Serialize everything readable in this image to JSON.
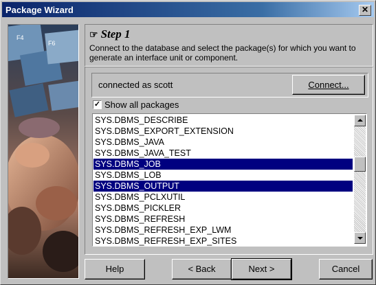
{
  "window": {
    "title": "Package Wizard",
    "close_label": "✕"
  },
  "step": {
    "title": "Step 1",
    "description": "Connect to the database and select the package(s) for which you want to generate an interface unit or component."
  },
  "connection": {
    "status": "connected as scott",
    "connect_button": "Connect..."
  },
  "show_all": {
    "checked": true,
    "mark": "✓",
    "label": "Show all packages"
  },
  "packages": [
    {
      "name": "SYS.DBMS_DESCRIBE",
      "selected": false
    },
    {
      "name": "SYS.DBMS_EXPORT_EXTENSION",
      "selected": false
    },
    {
      "name": "SYS.DBMS_JAVA",
      "selected": false
    },
    {
      "name": "SYS.DBMS_JAVA_TEST",
      "selected": false
    },
    {
      "name": "SYS.DBMS_JOB",
      "selected": true
    },
    {
      "name": "SYS.DBMS_LOB",
      "selected": false
    },
    {
      "name": "SYS.DBMS_OUTPUT",
      "selected": true
    },
    {
      "name": "SYS.DBMS_PCLXUTIL",
      "selected": false
    },
    {
      "name": "SYS.DBMS_PICKLER",
      "selected": false
    },
    {
      "name": "SYS.DBMS_REFRESH",
      "selected": false
    },
    {
      "name": "SYS.DBMS_REFRESH_EXP_LWM",
      "selected": false
    },
    {
      "name": "SYS.DBMS_REFRESH_EXP_SITES",
      "selected": false
    }
  ],
  "buttons": {
    "help": "Help",
    "back": "< Back",
    "next": "Next >",
    "cancel": "Cancel"
  },
  "colors": {
    "title_start": "#0a246a",
    "title_end": "#a6caf0",
    "selection": "#000080",
    "face": "#c0c0c0"
  }
}
